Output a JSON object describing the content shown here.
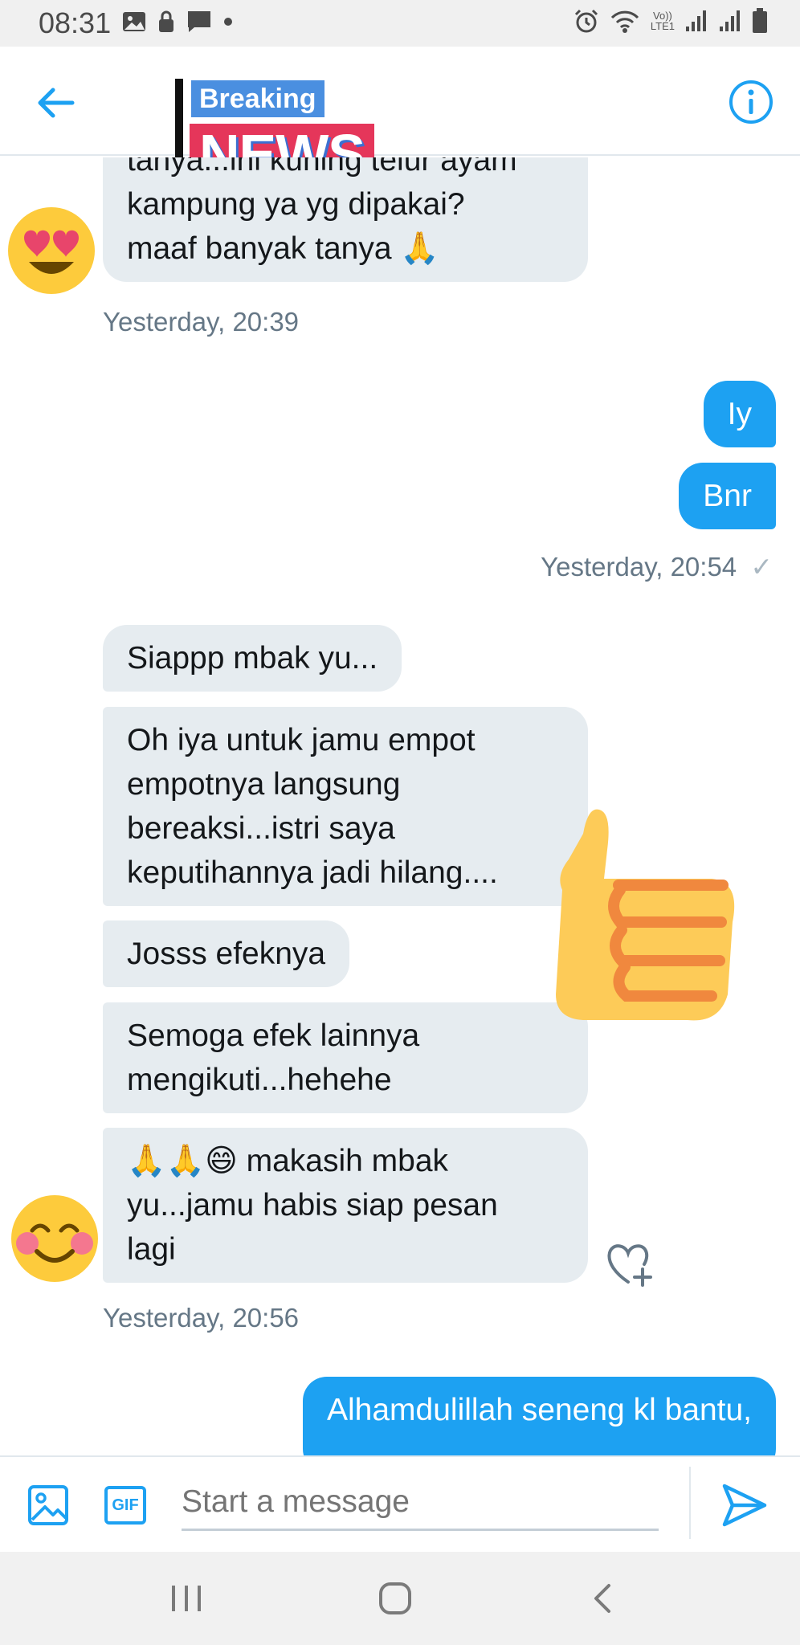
{
  "status_bar": {
    "time": "08:31",
    "left_icons": [
      "image-icon",
      "lock-icon",
      "message-icon",
      "dot-icon"
    ],
    "right_icons": [
      "alarm-icon",
      "wifi-icon",
      "volte-icon",
      "signal-icon",
      "signal-icon",
      "battery-icon"
    ],
    "volte_top": "Vo))",
    "volte_bottom": "LTE1"
  },
  "header": {
    "back_icon": "arrow-left-icon",
    "info_icon": "info-icon",
    "sticker_top": "Breaking",
    "sticker_bottom": "NEWS",
    "accent_color": "#1da1f2"
  },
  "messages": {
    "in1": {
      "lines": [
        "tanya...ini kuning telur ayam",
        "kampung ya yg dipakai?",
        "maaf banyak tanya 🙏"
      ]
    },
    "ts1": "Yesterday, 20:39",
    "out1": "Iy",
    "out2": "Bnr",
    "ts2": "Yesterday, 20:54",
    "ts2_check": "✓",
    "in2": "Siappp mbak yu...",
    "in3": {
      "lines": [
        "Oh iya untuk jamu empot",
        "empotnya langsung",
        "bereaksi...istri saya",
        "keputihannya jadi hilang...."
      ]
    },
    "in4": "Josss efeknya",
    "in5": {
      "lines": [
        "Semoga efek lainnya",
        "mengikuti...hehehe"
      ]
    },
    "in6": {
      "lines": [
        "🙏🙏😄 makasih mbak",
        "yu...jamu habis siap pesan",
        "lagi"
      ]
    },
    "ts3": "Yesterday, 20:56",
    "out3": "Alhamdulillah seneng kl bantu,"
  },
  "stickers": [
    "heart-eyes-emoji-icon",
    "thumbs-up-emoji-icon",
    "smiling-blush-emoji-icon"
  ],
  "like_icon": "heart-plus-icon",
  "composer": {
    "placeholder": "Start a message",
    "media_icon": "image-icon",
    "gif_label": "GIF",
    "send_icon": "send-icon"
  },
  "nav": {
    "recents_icon": "recents-icon",
    "home_icon": "home-icon",
    "back_icon": "back-chevron-icon"
  }
}
